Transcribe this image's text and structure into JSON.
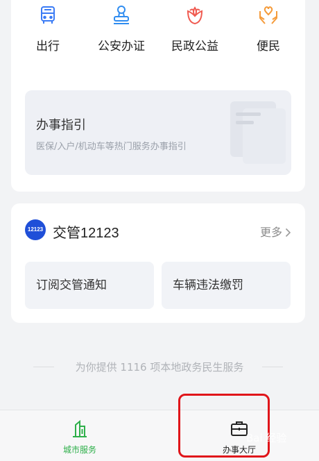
{
  "services": [
    {
      "label": "出行",
      "icon": "bus-icon",
      "color": "#3a7bf5"
    },
    {
      "label": "公安办证",
      "icon": "stamp-icon",
      "color": "#2f8cf0"
    },
    {
      "label": "民政公益",
      "icon": "flower-heart-icon",
      "color": "#f05a50"
    },
    {
      "label": "便民",
      "icon": "hands-heart-icon",
      "color": "#f59b3a"
    }
  ],
  "guide": {
    "title": "办事指引",
    "subtitle": "医保/入户/机动车等热门服务办事指引"
  },
  "traffic": {
    "logo_text": "12123",
    "title": "交管12123",
    "more_label": "更多",
    "tiles": [
      "订阅交管通知",
      "车辆违法缴罚"
    ]
  },
  "footer_note": "为你提供 1116 项本地政务民生服务",
  "tabbar": {
    "tabs": [
      {
        "label": "城市服务",
        "icon": "city-buildings-icon",
        "active": true,
        "color": "#2eaf4a"
      },
      {
        "label": "办事大厅",
        "icon": "briefcase-icon",
        "active": false,
        "color": "#222222"
      }
    ]
  },
  "watermark": "Bai 经验",
  "highlight_color": "#e0151a"
}
